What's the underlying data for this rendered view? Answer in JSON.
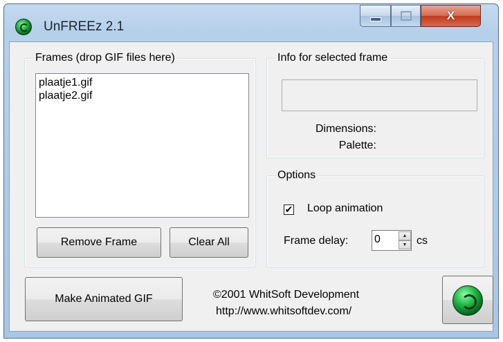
{
  "window": {
    "title": "UnFREEz 2.1",
    "close_glyph": "X"
  },
  "frames_group": {
    "legend": "Frames (drop GIF files here)",
    "files": [
      "plaatje1.gif",
      "plaatje2.gif"
    ],
    "remove_label": "Remove Frame",
    "clear_label": "Clear All"
  },
  "info_group": {
    "legend": "Info for selected frame",
    "dimensions_label": "Dimensions:",
    "palette_label": "Palette:"
  },
  "options_group": {
    "legend": "Options",
    "loop_label": "Loop animation",
    "loop_checked": true,
    "delay_label": "Frame delay:",
    "delay_value": "0",
    "delay_unit": "cs"
  },
  "footer": {
    "make_gif_label": "Make Animated GIF",
    "copyright": "©2001 WhitSoft Development",
    "url": "http://www.whitsoftdev.com/"
  },
  "icons": {
    "app": "unfreez-logo-icon",
    "minimize": "minimize-icon",
    "maximize": "maximize-icon",
    "close": "close-icon",
    "spin_up": "spin-up-icon",
    "spin_down": "spin-down-icon"
  }
}
